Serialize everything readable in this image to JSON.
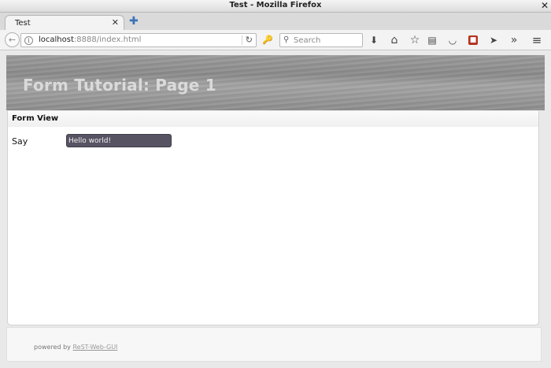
{
  "window": {
    "title": "Test - Mozilla Firefox",
    "close_glyph": "✕"
  },
  "tabs": [
    {
      "title": "Test",
      "close_glyph": "✕"
    }
  ],
  "new_tab_glyph": "✚",
  "nav": {
    "url_host": "localhost",
    "url_rest": ":8888/index.html",
    "search_placeholder": "Search"
  },
  "icons": {
    "back": "←",
    "info": "i",
    "reload": "↻",
    "extra": "🔑",
    "search": "⚲",
    "download": "⬇",
    "home": "⌂",
    "bookmark": "☆",
    "reader": "▤",
    "pocket": "◡",
    "addon": "■",
    "send": "➤",
    "overflow": "»",
    "menu": "≡"
  },
  "page": {
    "banner_title": "Form Tutorial: Page 1",
    "panel_title": "Form View",
    "form": {
      "label": "Say",
      "value": "Hello world!"
    },
    "footer": {
      "prefix": "powered by ",
      "link": "ReST-Web-GUI"
    }
  },
  "colors": {
    "banner": "#919191",
    "input_bg": "#575363",
    "link": "#999999"
  }
}
